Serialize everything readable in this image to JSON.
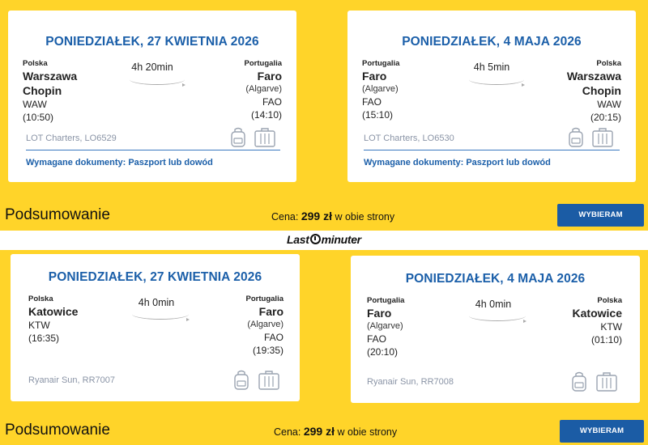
{
  "offers": [
    {
      "outbound": {
        "date": "PONIEDZIAŁEK, 27 KWIETNIA 2026",
        "from": {
          "country": "Polska",
          "city": [
            "Warszawa",
            "Chopin"
          ],
          "code": "WAW",
          "time": "(10:50)"
        },
        "to": {
          "country": "Portugalia",
          "city": [
            "Faro"
          ],
          "region": "(Algarve)",
          "code": "FAO",
          "time": "(14:10)"
        },
        "duration": "4h 20min",
        "carrier": "LOT Charters, LO6529",
        "docs": "Wymagane dokumenty: Paszport lub dowód"
      },
      "return": {
        "date": "PONIEDZIAŁEK, 4 MAJA 2026",
        "from": {
          "country": "Portugalia",
          "city": [
            "Faro"
          ],
          "region": "(Algarve)",
          "code": "FAO",
          "time": "(15:10)"
        },
        "to": {
          "country": "Polska",
          "city": [
            "Warszawa",
            "Chopin"
          ],
          "code": "WAW",
          "time": "(20:15)"
        },
        "duration": "4h 5min",
        "carrier": "LOT Charters, LO6530",
        "docs": "Wymagane dokumenty: Paszport lub dowód"
      },
      "summary": "Podsumowanie",
      "price_label": "Cena:",
      "price_value": "299 zł",
      "price_suffix": "w obie strony",
      "button": "WYBIERAM"
    },
    {
      "outbound": {
        "date": "PONIEDZIAŁEK, 27 KWIETNIA 2026",
        "from": {
          "country": "Polska",
          "city": [
            "Katowice"
          ],
          "code": "KTW",
          "time": "(16:35)"
        },
        "to": {
          "country": "Portugalia",
          "city": [
            "Faro"
          ],
          "region": "(Algarve)",
          "code": "FAO",
          "time": "(19:35)"
        },
        "duration": "4h 0min",
        "carrier": "Ryanair Sun, RR7007"
      },
      "return": {
        "date": "PONIEDZIAŁEK, 4 MAJA 2026",
        "from": {
          "country": "Portugalia",
          "city": [
            "Faro"
          ],
          "region": "(Algarve)",
          "code": "FAO",
          "time": "(20:10)"
        },
        "to": {
          "country": "Polska",
          "city": [
            "Katowice"
          ],
          "code": "KTW",
          "time": "(01:10)"
        },
        "duration": "4h 0min",
        "carrier": "Ryanair Sun, RR7008"
      },
      "summary": "Podsumowanie",
      "price_label": "Cena:",
      "price_value": "299 zł",
      "price_suffix": "w obie strony",
      "button": "WYBIERAM"
    }
  ],
  "brand": {
    "part1": "Last",
    "part2": "minuter"
  },
  "icons": {
    "baggage": "backpack-icon",
    "suitcase": "suitcase-icon"
  },
  "colors": {
    "background": "#ffd429",
    "accent": "#1b5fa9",
    "button": "#1b5ca5"
  }
}
